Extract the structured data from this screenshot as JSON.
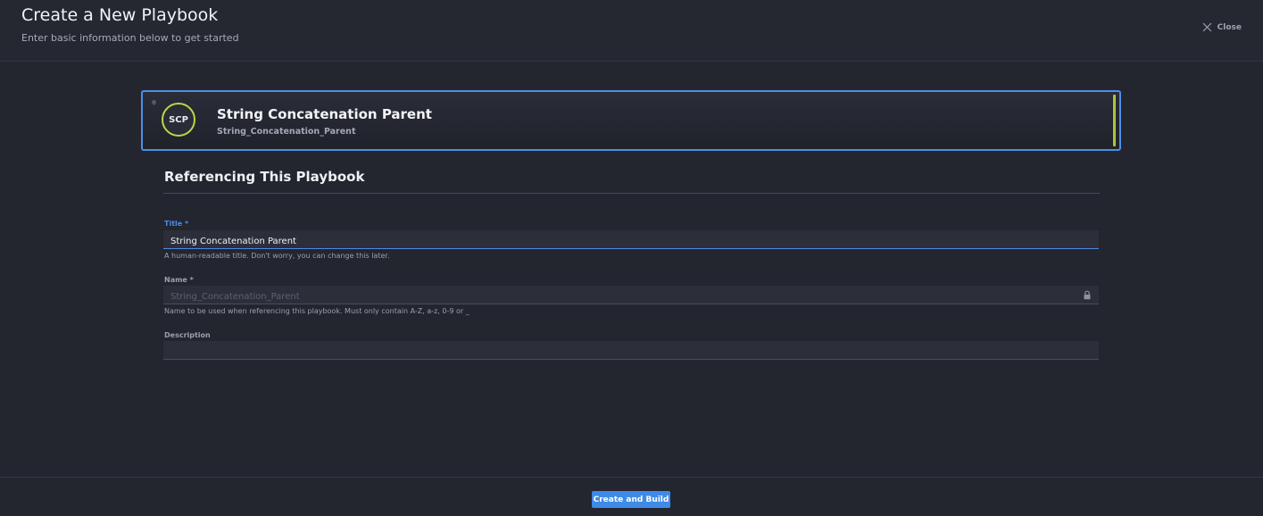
{
  "header": {
    "title": "Create a New Playbook",
    "subtitle": "Enter basic information below to get started",
    "close_label": "Close"
  },
  "playbook_card": {
    "initials": "SCP",
    "name": "String Concatenation Parent",
    "slug": "String_Concatenation_Parent",
    "ring_color": "#b9d64a",
    "accent_color": "#a8c83a"
  },
  "section": {
    "title": "Referencing This Playbook"
  },
  "form": {
    "title_field": {
      "label": "Title *",
      "value": "String Concatenation Parent",
      "hint": "A human-readable title. Don't worry, you can change this later."
    },
    "name_field": {
      "label": "Name *",
      "value": "String_Concatenation_Parent",
      "hint": "Name to be used when referencing this playbook. Must only contain A-Z, a-z, 0-9 or _",
      "locked": true
    },
    "description_field": {
      "label": "Description",
      "value": ""
    }
  },
  "footer": {
    "primary_label": "Create and Build"
  },
  "colors": {
    "background": "#23252f",
    "primary": "#3f8ae6",
    "focus": "#4c8ae4"
  }
}
